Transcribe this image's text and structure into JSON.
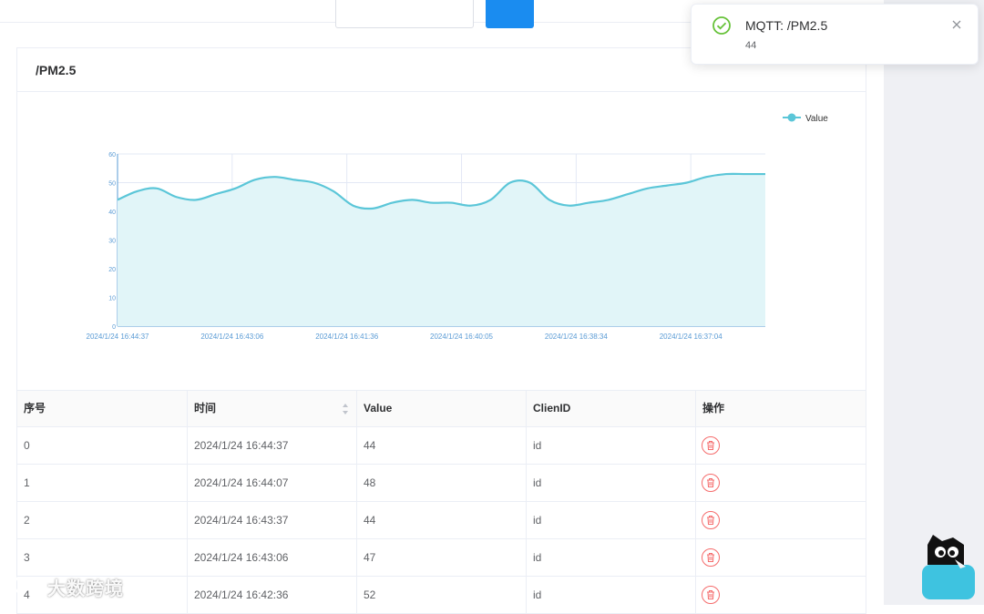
{
  "page": {
    "title": "/PM2.5"
  },
  "notification": {
    "title": "MQTT: /PM2.5",
    "message": "44"
  },
  "chart_data": {
    "type": "area",
    "title": "",
    "legend": "Value",
    "legend_position": "top-right",
    "ylim": [
      0,
      60
    ],
    "yticks": [
      "0",
      "10",
      "20",
      "30",
      "40",
      "50",
      "60"
    ],
    "x_tick_labels": [
      "2024/1/24 16:44:37",
      "2024/1/24 16:43:06",
      "2024/1/24 16:41:36",
      "2024/1/24 16:40:05",
      "2024/1/24 16:38:34",
      "2024/1/24 16:37:04"
    ],
    "series": [
      {
        "name": "Value",
        "values": [
          44,
          47,
          48,
          45,
          44,
          46,
          48,
          51,
          52,
          51,
          50,
          47,
          42,
          41,
          43,
          44,
          43,
          43,
          42,
          44,
          50,
          50,
          44,
          42,
          43,
          44,
          46,
          48,
          49,
          50,
          52,
          53,
          53,
          53
        ]
      }
    ],
    "color": "#5bc6d8",
    "fill": "#e1f5f8",
    "grid": true
  },
  "table": {
    "headers": [
      "序号",
      "时间",
      "Value",
      "ClienID",
      "操作"
    ],
    "rows": [
      [
        "0",
        "2024/1/24 16:44:37",
        "44",
        "id"
      ],
      [
        "1",
        "2024/1/24 16:44:07",
        "48",
        "id"
      ],
      [
        "2",
        "2024/1/24 16:43:37",
        "44",
        "id"
      ],
      [
        "3",
        "2024/1/24 16:43:06",
        "47",
        "id"
      ],
      [
        "4",
        "2024/1/24 16:42:36",
        "52",
        "id"
      ]
    ]
  },
  "watermark": "大数跨境",
  "icons": {
    "success": "check-circle-icon",
    "close": "close-icon",
    "delete": "trash-icon",
    "sort": "sort-caret-icon"
  },
  "colors": {
    "accent": "#1a8cf0",
    "success": "#67c23a",
    "danger": "#f56c6c",
    "line": "#5bc6d8"
  }
}
